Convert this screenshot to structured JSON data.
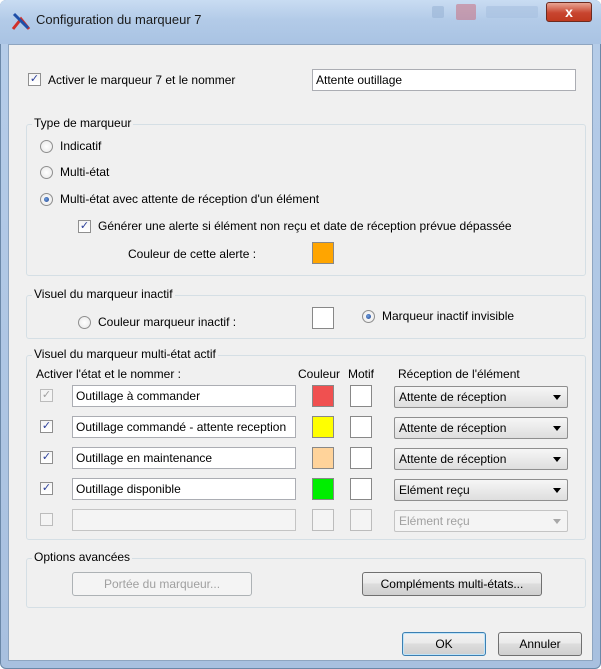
{
  "window": {
    "title": "Configuration du marqueur 7",
    "close_glyph": "x"
  },
  "activate": {
    "checked": true,
    "label": "Activer le marqueur 7 et le nommer",
    "name_value": "Attente outillage"
  },
  "type_group": {
    "title": "Type de marqueur",
    "options": [
      "Indicatif",
      "Multi-état",
      "Multi-état avec attente de réception d'un élément"
    ],
    "selected_index": 2,
    "alert_checked": true,
    "alert_label": "Générer une alerte si élément non reçu et date de réception prévue dépassée",
    "alert_color_label": "Couleur de cette alerte :",
    "alert_color": "#ffa500"
  },
  "inactive_group": {
    "title": "Visuel du marqueur inactif",
    "color_option": "Couleur marqueur inactif :",
    "invisible_option": "Marqueur inactif invisible",
    "selected": "invisible"
  },
  "active_group": {
    "title": "Visuel du marqueur multi-état actif",
    "headers": {
      "activate": "Activer l'état et le nommer :",
      "color": "Couleur",
      "motif": "Motif",
      "reception": "Réception de l'élément"
    },
    "rows": [
      {
        "checked": true,
        "disabled_check": true,
        "name": "Outillage à commander",
        "color": "#f05050",
        "reception": "Attente de réception"
      },
      {
        "checked": true,
        "disabled_check": false,
        "name": "Outillage commandé - attente reception",
        "color": "#ffff00",
        "reception": "Attente de réception"
      },
      {
        "checked": true,
        "disabled_check": false,
        "name": "Outillage en maintenance",
        "color": "#ffd39a",
        "reception": "Attente de réception"
      },
      {
        "checked": true,
        "disabled_check": false,
        "name": "Outillage disponible",
        "color": "#00ee00",
        "reception": "Elément reçu"
      },
      {
        "checked": false,
        "disabled_check": false,
        "name": "",
        "color": "",
        "reception": "Elément reçu",
        "disabled": true
      }
    ]
  },
  "advanced_group": {
    "title": "Options avancées",
    "scope_button": "Portée du marqueur...",
    "complements_button": "Compléments multi-états..."
  },
  "footer": {
    "ok": "OK",
    "cancel": "Annuler"
  },
  "colors": {
    "titlebar": "#b3cbe8",
    "client_bg": "#f0f0f0",
    "close_red": "#c8452f"
  }
}
